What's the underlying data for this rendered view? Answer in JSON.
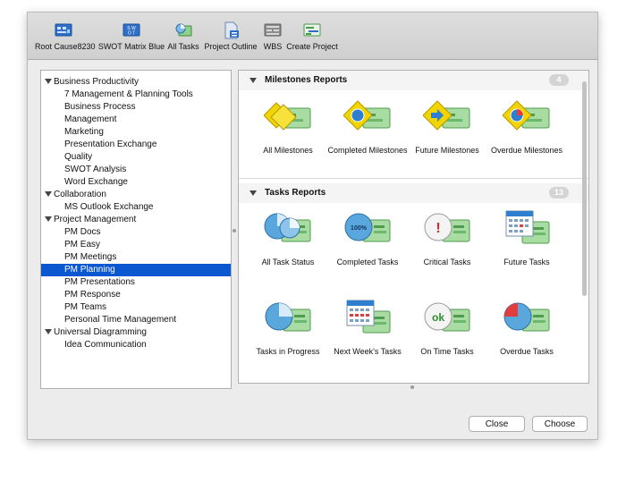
{
  "toolbar": {
    "items": [
      {
        "label": "Root Cause8230",
        "icon": "root-cause-icon"
      },
      {
        "label": "SWOT Matrix Blue",
        "icon": "swot-matrix-icon"
      },
      {
        "label": "All Tasks",
        "icon": "all-tasks-icon"
      },
      {
        "label": "Project Outline",
        "icon": "project-outline-icon"
      },
      {
        "label": "WBS",
        "icon": "wbs-icon"
      },
      {
        "label": "Create Project",
        "icon": "create-project-icon"
      }
    ]
  },
  "tree": {
    "items": [
      {
        "label": "Business Productivity",
        "level": 0
      },
      {
        "label": "7 Management & Planning Tools",
        "level": 1
      },
      {
        "label": "Business Process",
        "level": 1
      },
      {
        "label": "Management",
        "level": 1
      },
      {
        "label": "Marketing",
        "level": 1
      },
      {
        "label": "Presentation Exchange",
        "level": 1
      },
      {
        "label": "Quality",
        "level": 1
      },
      {
        "label": "SWOT Analysis",
        "level": 1
      },
      {
        "label": "Word Exchange",
        "level": 1
      },
      {
        "label": "Collaboration",
        "level": 0
      },
      {
        "label": "MS Outlook Exchange",
        "level": 1
      },
      {
        "label": "Project Management",
        "level": 0
      },
      {
        "label": "PM Docs",
        "level": 1
      },
      {
        "label": "PM Easy",
        "level": 1
      },
      {
        "label": "PM Meetings",
        "level": 1
      },
      {
        "label": "PM Planning",
        "level": 1,
        "selected": true
      },
      {
        "label": "PM Presentations",
        "level": 1
      },
      {
        "label": "PM Response",
        "level": 1
      },
      {
        "label": "PM Teams",
        "level": 1
      },
      {
        "label": "Personal Time Management",
        "level": 1
      },
      {
        "label": "Universal Diagramming",
        "level": 0
      },
      {
        "label": "Idea Communication",
        "level": 1
      }
    ]
  },
  "milestones": {
    "title": "Milestones Reports",
    "count": "4",
    "tiles": [
      {
        "label": "All Milestones",
        "icon": "all-milestones-icon"
      },
      {
        "label": "Completed Milestones",
        "icon": "completed-milestones-icon"
      },
      {
        "label": "Future Milestones",
        "icon": "future-milestones-icon"
      },
      {
        "label": "Overdue Milestones",
        "icon": "overdue-milestones-icon"
      }
    ]
  },
  "tasks": {
    "title": "Tasks Reports",
    "count": "13",
    "tiles": [
      {
        "label": "All Task Status",
        "icon": "all-task-status-icon"
      },
      {
        "label": "Completed Tasks",
        "icon": "completed-tasks-icon",
        "badge": "100%"
      },
      {
        "label": "Critical Tasks",
        "icon": "critical-tasks-icon",
        "badge": "!"
      },
      {
        "label": "Future Tasks",
        "icon": "future-tasks-icon"
      },
      {
        "label": "Tasks in Progress",
        "icon": "tasks-in-progress-icon"
      },
      {
        "label": "Next Week's Tasks",
        "icon": "next-weeks-tasks-icon"
      },
      {
        "label": "On Time Tasks",
        "icon": "on-time-tasks-icon",
        "badge": "ok"
      },
      {
        "label": "Overdue Tasks",
        "icon": "overdue-tasks-icon"
      }
    ]
  },
  "buttons": {
    "close": "Close",
    "choose": "Choose"
  }
}
